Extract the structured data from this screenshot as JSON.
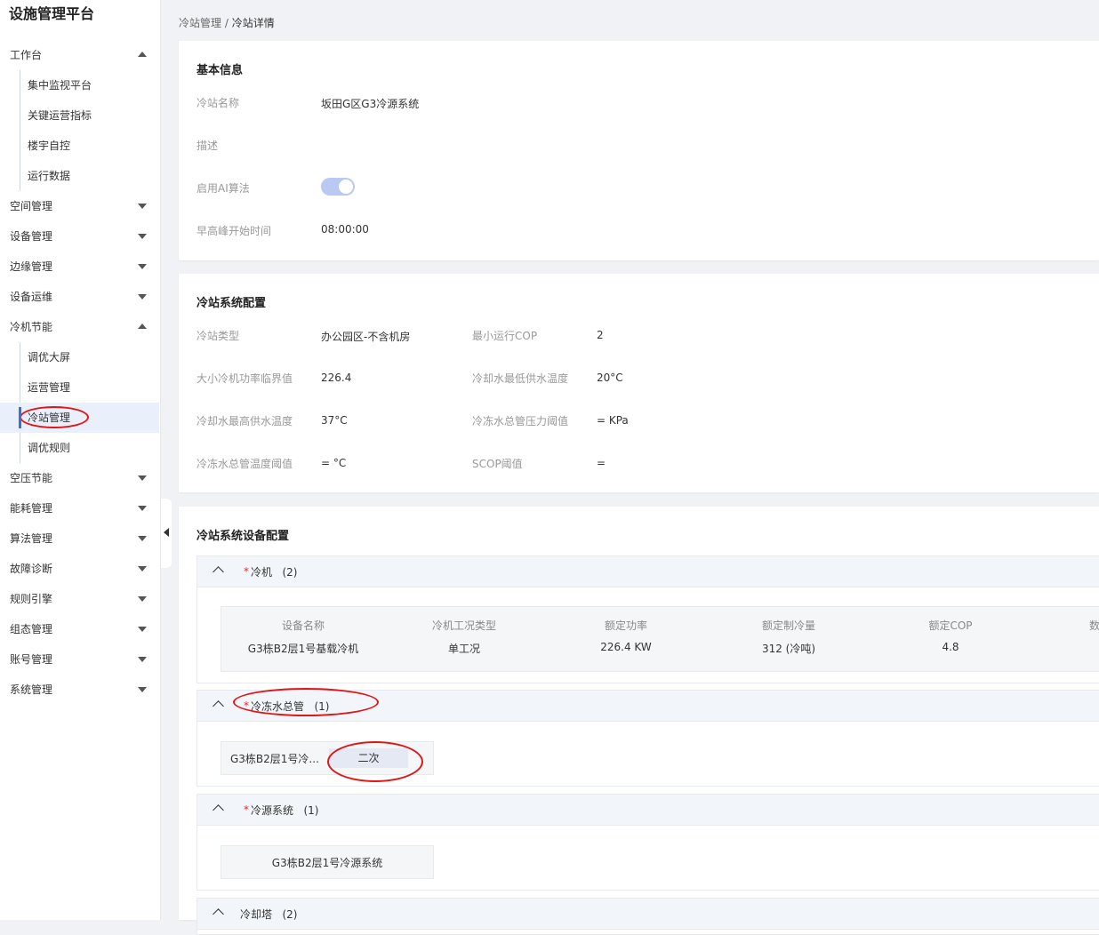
{
  "app": {
    "title": "设施管理平台"
  },
  "sidebar": {
    "groups": [
      {
        "label": "工作台",
        "expanded": true,
        "children": [
          "集中监视平台",
          "关键运营指标",
          "楼宇自控",
          "运行数据"
        ]
      },
      {
        "label": "空间管理",
        "expanded": false
      },
      {
        "label": "设备管理",
        "expanded": false
      },
      {
        "label": "边缘管理",
        "expanded": false
      },
      {
        "label": "设备运维",
        "expanded": false
      },
      {
        "label": "冷机节能",
        "expanded": true,
        "children": [
          "调优大屏",
          "运营管理",
          "冷站管理",
          "调优规则"
        ],
        "active_child": "冷站管理"
      },
      {
        "label": "空压节能",
        "expanded": false
      },
      {
        "label": "能耗管理",
        "expanded": false
      },
      {
        "label": "算法管理",
        "expanded": false
      },
      {
        "label": "故障诊断",
        "expanded": false
      },
      {
        "label": "规则引擎",
        "expanded": false
      },
      {
        "label": "组态管理",
        "expanded": false
      },
      {
        "label": "账号管理",
        "expanded": false
      },
      {
        "label": "系统管理",
        "expanded": false
      }
    ]
  },
  "breadcrumb": {
    "parent": "冷站管理",
    "separator": "/",
    "current": "冷站详情"
  },
  "basic_info": {
    "title": "基本信息",
    "name_label": "冷站名称",
    "name_value": "坂田G区G3冷源系统",
    "desc_label": "描述",
    "desc_value": "",
    "ai_label": "启用AI算法",
    "ai_enabled": true,
    "peak_label": "早高峰开始时间",
    "peak_value": "08:00:00"
  },
  "system_config": {
    "title": "冷站系统配置",
    "fields": [
      {
        "label": "冷站类型",
        "value": "办公园区-不含机房"
      },
      {
        "label": "最小运行COP",
        "value": "2"
      },
      {
        "label": "大小冷机功率临界值",
        "value": "226.4"
      },
      {
        "label": "冷却水最低供水温度",
        "value": "20°C"
      },
      {
        "label": "冷却水最高供水温度",
        "value": "37°C"
      },
      {
        "label": "冷冻水总管压力阈值",
        "value": "= KPa"
      },
      {
        "label": "冷冻水总管温度阈值",
        "value": "= °C"
      },
      {
        "label": "SCOP阈值",
        "value": "="
      }
    ]
  },
  "equipment_config": {
    "title": "冷站系统设备配置",
    "chiller": {
      "label": "冷机",
      "count": "(2)",
      "required": "*",
      "headers": [
        "设备名称",
        "冷机工况类型",
        "额定功率",
        "额定制冷量",
        "额定COP",
        "数"
      ],
      "rows": [
        [
          "G3栋B2层1号基载冷机",
          "单工况",
          "226.4 KW",
          "312 (冷吨)",
          "4.8"
        ]
      ]
    },
    "main_pipe": {
      "label": "冷冻水总管",
      "count": "(1)",
      "required": "*",
      "item": "G3栋B2层1号冷...",
      "tag": "二次"
    },
    "source_system": {
      "label": "冷源系统",
      "count": "(1)",
      "required": "*",
      "item": "G3栋B2层1号冷源系统"
    },
    "cooling_tower": {
      "label": "冷却塔",
      "count": "(2)"
    }
  },
  "colors": {
    "accent": "#3b6fd8",
    "annotation": "#e01515",
    "toggle": "#b9c9f2"
  }
}
